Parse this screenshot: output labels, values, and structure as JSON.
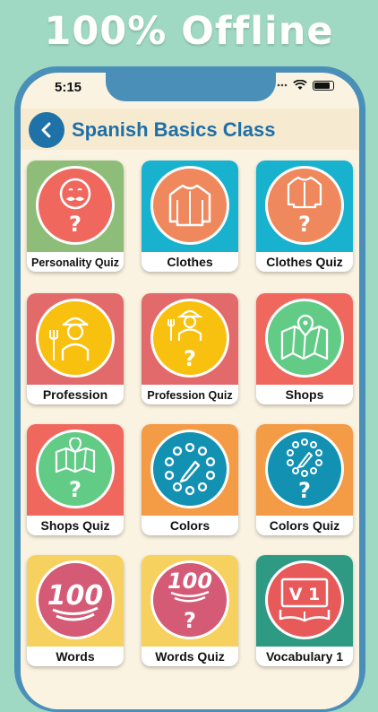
{
  "banner": "100% Offline",
  "status_bar": {
    "time": "5:15"
  },
  "header": {
    "title": "Spanish Basics Class"
  },
  "tiles": [
    {
      "label": "Personality Quiz",
      "icon": "mustache-face-quiz-icon",
      "bg": "#8dbd78",
      "circle": "#f0685d"
    },
    {
      "label": "Clothes",
      "icon": "jacket-icon",
      "bg": "#18b2cf",
      "circle": "#f0885d"
    },
    {
      "label": "Clothes Quiz",
      "icon": "jacket-quiz-icon",
      "bg": "#18b2cf",
      "circle": "#f0885d"
    },
    {
      "label": "Profession",
      "icon": "farmer-icon",
      "bg": "#e26a6a",
      "circle": "#f8c10f"
    },
    {
      "label": "Profession Quiz",
      "icon": "farmer-quiz-icon",
      "bg": "#e26a6a",
      "circle": "#f8c10f"
    },
    {
      "label": "Shops",
      "icon": "map-pin-icon",
      "bg": "#f0685d",
      "circle": "#62cc87"
    },
    {
      "label": "Shops Quiz",
      "icon": "map-pin-quiz-icon",
      "bg": "#f0685d",
      "circle": "#62cc87"
    },
    {
      "label": "Colors",
      "icon": "color-palette-icon",
      "bg": "#f39b45",
      "circle": "#1391b3"
    },
    {
      "label": "Colors Quiz",
      "icon": "color-palette-quiz-icon",
      "bg": "#f39b45",
      "circle": "#1391b3"
    },
    {
      "label": "Words",
      "icon": "hundred-emoji-icon",
      "bg": "#f7d160",
      "circle": "#d45a76"
    },
    {
      "label": "Words Quiz",
      "icon": "hundred-emoji-quiz-icon",
      "bg": "#f7d160",
      "circle": "#d45a76"
    },
    {
      "label": "Vocabulary 1",
      "icon": "book-v1-icon",
      "bg": "#2e9a84",
      "circle": "#e85a5a",
      "book_text": "V 1"
    }
  ]
}
